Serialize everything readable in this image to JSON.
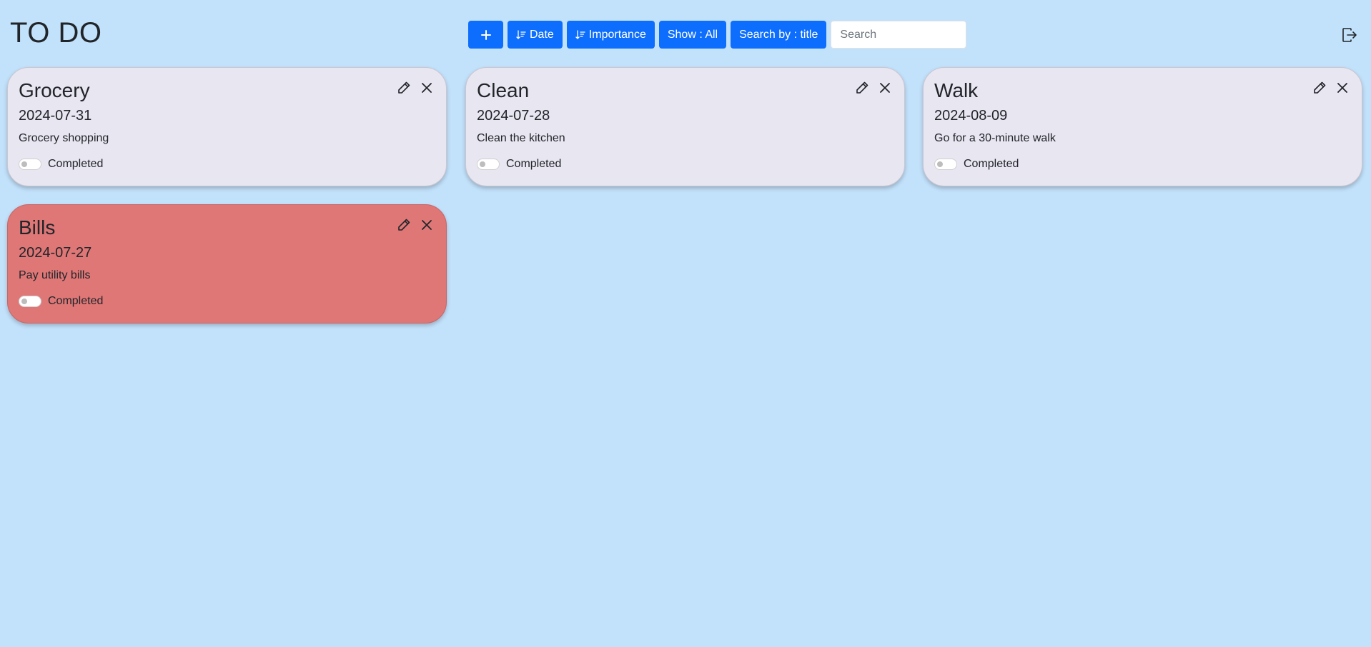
{
  "app": {
    "title": "TO DO"
  },
  "toolbar": {
    "add_label": "+",
    "sort_date_label": "Date",
    "sort_importance_label": "Importance",
    "show_label": "Show : All",
    "search_by_label": "Search by : title",
    "search_placeholder": "Search",
    "search_value": ""
  },
  "tasks": [
    {
      "title": "Grocery",
      "date": "2024-07-31",
      "description": "Grocery shopping",
      "completed_label": "Completed",
      "completed": false,
      "important": false
    },
    {
      "title": "Clean",
      "date": "2024-07-28",
      "description": "Clean the kitchen",
      "completed_label": "Completed",
      "completed": false,
      "important": false
    },
    {
      "title": "Walk",
      "date": "2024-08-09",
      "description": "Go for a 30-minute walk",
      "completed_label": "Completed",
      "completed": false,
      "important": false
    },
    {
      "title": "Bills",
      "date": "2024-07-27",
      "description": "Pay utility bills",
      "completed_label": "Completed",
      "completed": false,
      "important": true
    }
  ],
  "colors": {
    "background": "#c2e1fb",
    "primary_button": "#0d6efd",
    "card": "#e8e6f1",
    "card_important": "#df7777"
  },
  "icons": {
    "add": "plus-icon",
    "sort": "sort-down-icon",
    "edit": "pencil-icon",
    "delete": "close-icon",
    "logout": "logout-icon"
  }
}
